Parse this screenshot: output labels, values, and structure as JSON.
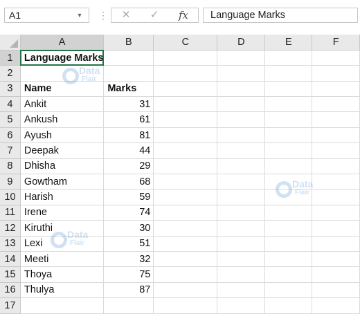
{
  "formula_bar": {
    "name_box": "A1",
    "cancel_icon": "close-icon",
    "enter_icon": "check-icon",
    "fx_label": "fx",
    "formula_value": "Language Marks"
  },
  "columns": [
    "A",
    "B",
    "C",
    "D",
    "E",
    "F"
  ],
  "rows": [
    {
      "n": "1",
      "a": "Language Marks",
      "b": "",
      "bold": true
    },
    {
      "n": "2",
      "a": "",
      "b": ""
    },
    {
      "n": "3",
      "a": "Name",
      "b": "Marks",
      "bold": true
    },
    {
      "n": "4",
      "a": "Ankit",
      "b": "31"
    },
    {
      "n": "5",
      "a": "Ankush",
      "b": "61"
    },
    {
      "n": "6",
      "a": "Ayush",
      "b": "81"
    },
    {
      "n": "7",
      "a": "Deepak",
      "b": "44"
    },
    {
      "n": "8",
      "a": "Dhisha",
      "b": "29"
    },
    {
      "n": "9",
      "a": "Gowtham",
      "b": "68"
    },
    {
      "n": "10",
      "a": "Harish",
      "b": "59"
    },
    {
      "n": "11",
      "a": "Irene",
      "b": "74"
    },
    {
      "n": "12",
      "a": "Kiruthi",
      "b": "30"
    },
    {
      "n": "13",
      "a": "Lexi",
      "b": "51"
    },
    {
      "n": "14",
      "a": "Meeti",
      "b": "32"
    },
    {
      "n": "15",
      "a": "Thoya",
      "b": "75"
    },
    {
      "n": "16",
      "a": "Thulya",
      "b": "87"
    },
    {
      "n": "17",
      "a": "",
      "b": ""
    }
  ],
  "watermark": {
    "line1": "Data",
    "line2": "Flair"
  }
}
